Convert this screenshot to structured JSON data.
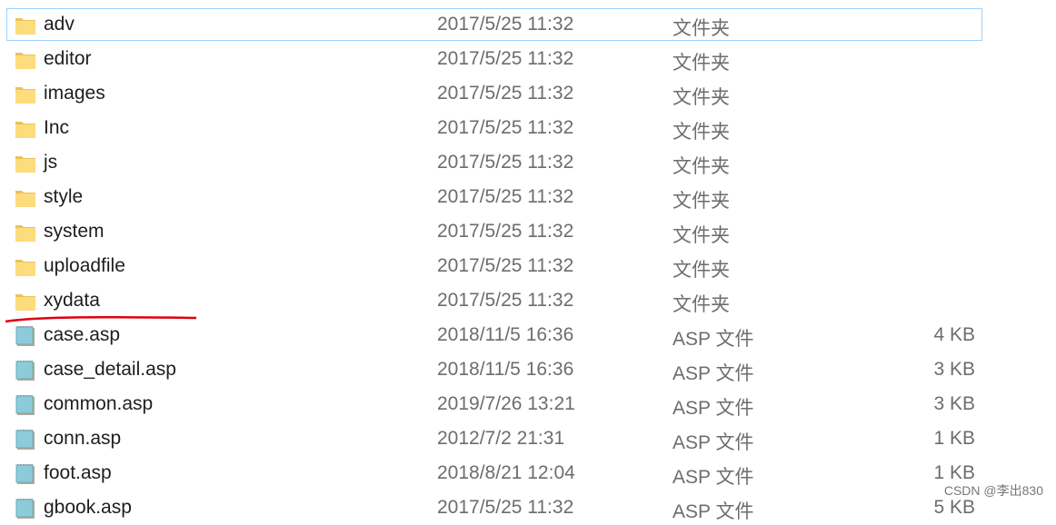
{
  "files": [
    {
      "name": "adv",
      "date": "2017/5/25 11:32",
      "type": "文件夹",
      "size": "",
      "icon": "folder-icon",
      "selected": true
    },
    {
      "name": "editor",
      "date": "2017/5/25 11:32",
      "type": "文件夹",
      "size": "",
      "icon": "folder-icon"
    },
    {
      "name": "images",
      "date": "2017/5/25 11:32",
      "type": "文件夹",
      "size": "",
      "icon": "folder-icon"
    },
    {
      "name": "Inc",
      "date": "2017/5/25 11:32",
      "type": "文件夹",
      "size": "",
      "icon": "folder-icon"
    },
    {
      "name": "js",
      "date": "2017/5/25 11:32",
      "type": "文件夹",
      "size": "",
      "icon": "folder-icon"
    },
    {
      "name": "style",
      "date": "2017/5/25 11:32",
      "type": "文件夹",
      "size": "",
      "icon": "folder-icon"
    },
    {
      "name": "system",
      "date": "2017/5/25 11:32",
      "type": "文件夹",
      "size": "",
      "icon": "folder-icon"
    },
    {
      "name": "uploadfile",
      "date": "2017/5/25 11:32",
      "type": "文件夹",
      "size": "",
      "icon": "folder-icon"
    },
    {
      "name": "xydata",
      "date": "2017/5/25 11:32",
      "type": "文件夹",
      "size": "",
      "icon": "folder-icon"
    },
    {
      "name": "case.asp",
      "date": "2018/11/5 16:36",
      "type": "ASP 文件",
      "size": "4 KB",
      "icon": "asp-file-icon"
    },
    {
      "name": "case_detail.asp",
      "date": "2018/11/5 16:36",
      "type": "ASP 文件",
      "size": "3 KB",
      "icon": "asp-file-icon"
    },
    {
      "name": "common.asp",
      "date": "2019/7/26 13:21",
      "type": "ASP 文件",
      "size": "3 KB",
      "icon": "asp-file-icon"
    },
    {
      "name": "conn.asp",
      "date": "2012/7/2 21:31",
      "type": "ASP 文件",
      "size": "1 KB",
      "icon": "asp-file-icon"
    },
    {
      "name": "foot.asp",
      "date": "2018/8/21 12:04",
      "type": "ASP 文件",
      "size": "1 KB",
      "icon": "asp-file-icon"
    },
    {
      "name": "gbook.asp",
      "date": "2017/5/25 11:32",
      "type": "ASP 文件",
      "size": "5 KB",
      "icon": "asp-file-icon"
    }
  ],
  "annotation_color": "#e0000f",
  "watermark": "CSDN @李出830"
}
